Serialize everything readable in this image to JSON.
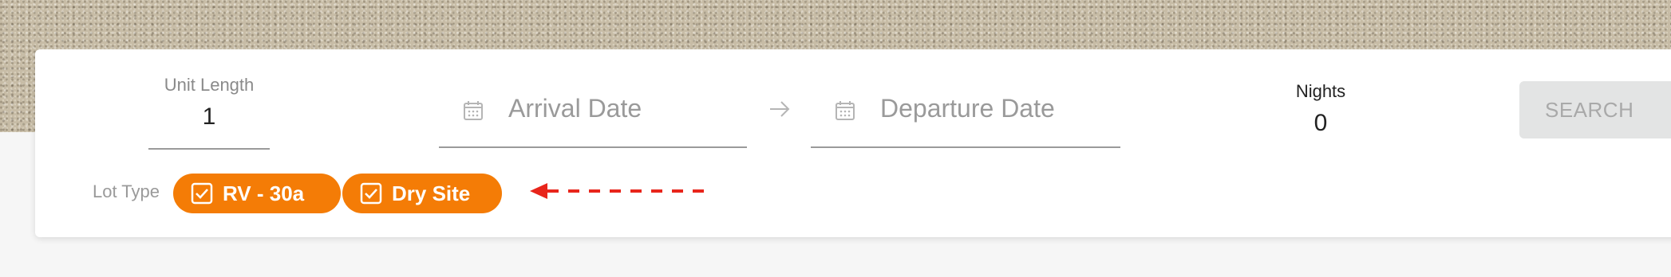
{
  "filters": {
    "unit_length": {
      "label": "Unit Length",
      "value": "1"
    },
    "arrival": {
      "placeholder": "Arrival Date",
      "icon": "calendar-icon"
    },
    "departure": {
      "placeholder": "Departure Date",
      "icon": "calendar-icon"
    },
    "range_icon": "arrow-right-icon",
    "nights": {
      "label": "Nights",
      "value": "0"
    },
    "search_label": "SEARCH",
    "lot_type": {
      "label": "Lot Type",
      "options": [
        {
          "label": "RV - 30a",
          "checked": true
        },
        {
          "label": "Dry Site",
          "checked": true
        }
      ]
    }
  },
  "colors": {
    "chip_accent": "#f47c06",
    "annotation_arrow": "#e8251b",
    "search_disabled_bg": "#e3e4e4"
  }
}
